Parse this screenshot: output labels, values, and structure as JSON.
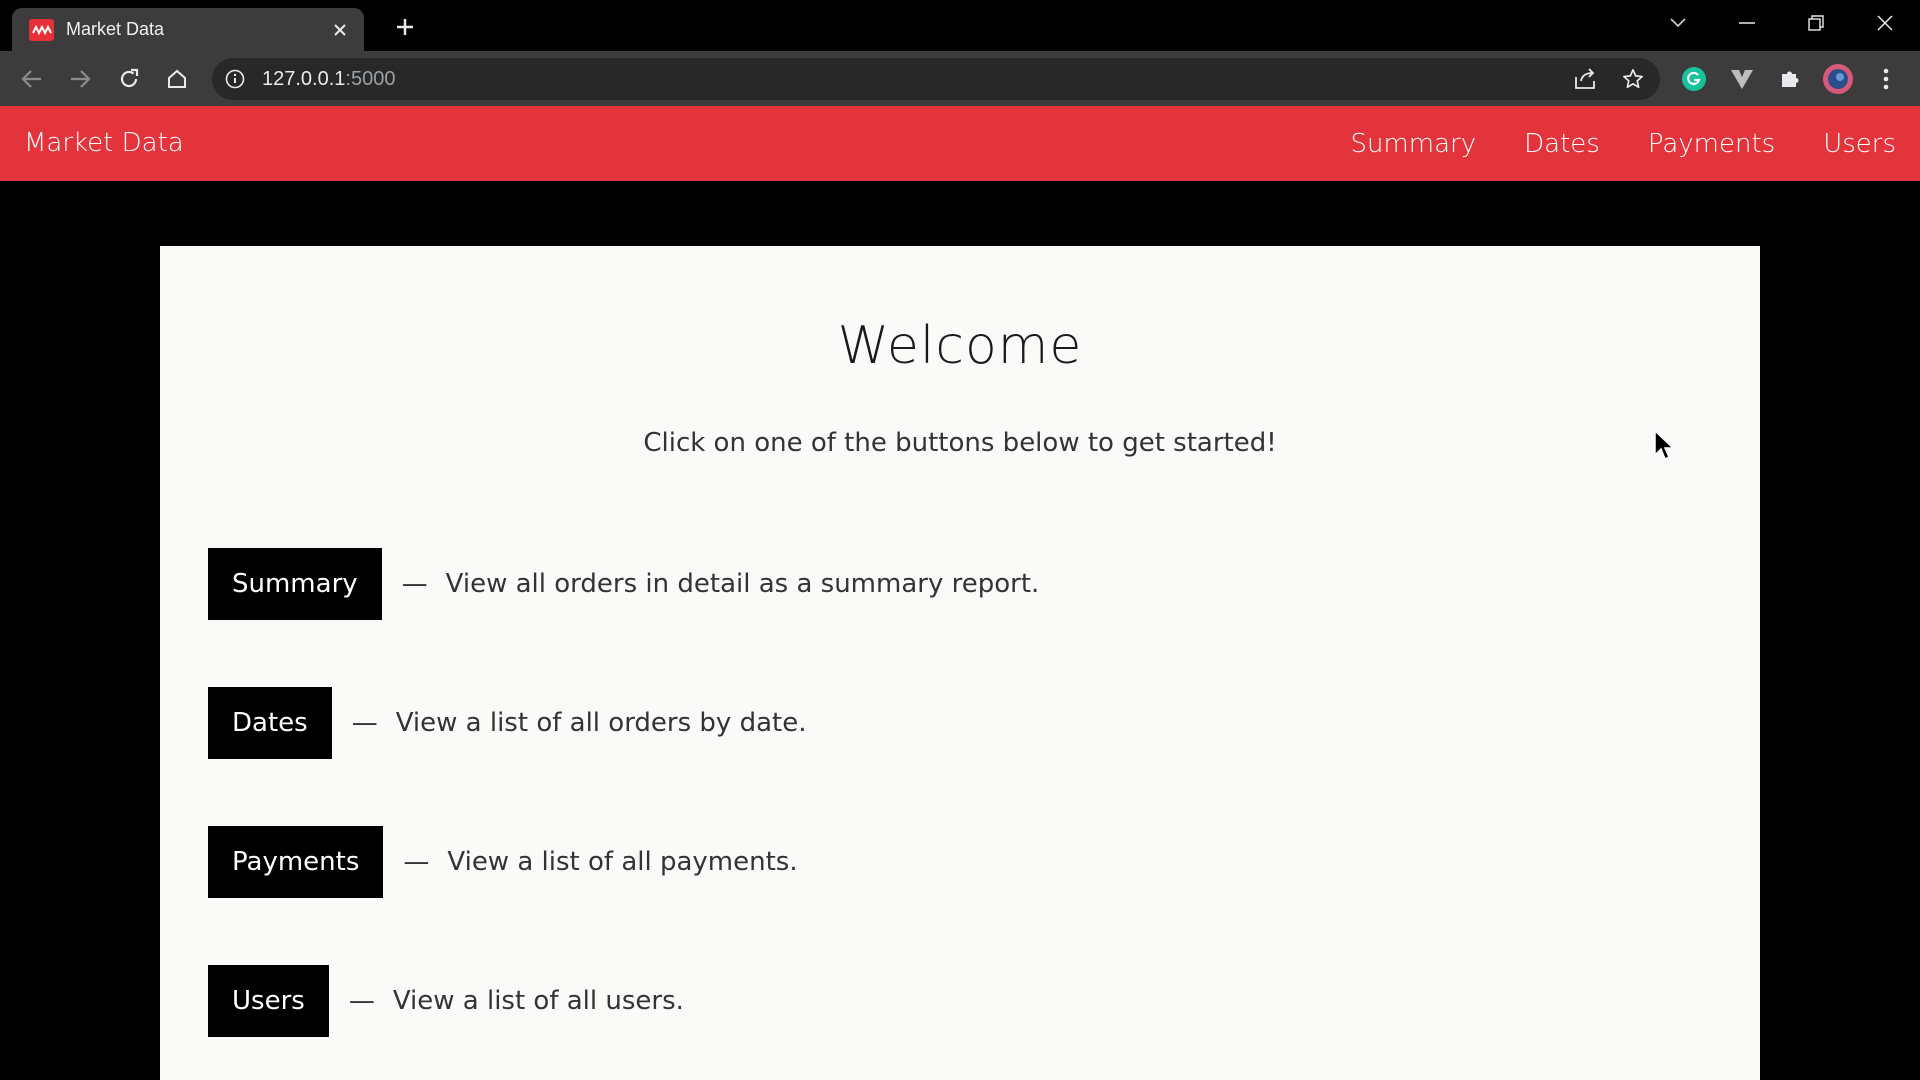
{
  "browser": {
    "tab_title": "Market Data",
    "url_host": "127.0.0.1",
    "url_port": ":5000",
    "theme": {
      "chrome_bg": "#000000",
      "toolbar_bg": "#3c3c3c",
      "omnibox_bg": "#282828"
    }
  },
  "navbar": {
    "brand": "Market Data",
    "links": [
      "Summary",
      "Dates",
      "Payments",
      "Users"
    ],
    "color": "#e3343c"
  },
  "main": {
    "title": "Welcome",
    "subtitle": "Click on one of the buttons below to get started!",
    "dash": "—",
    "actions": [
      {
        "label": "Summary",
        "description": "View all orders in detail as a summary report."
      },
      {
        "label": "Dates",
        "description": "View a list of all orders by date."
      },
      {
        "label": "Payments",
        "description": "View a list of all payments."
      },
      {
        "label": "Users",
        "description": "View a list of all users."
      }
    ]
  },
  "icons": {
    "favicon": "market-logo-icon",
    "tab_close": "close-icon",
    "new_tab": "plus-icon",
    "window": [
      "chevron-down-icon",
      "minimize-icon",
      "restore-icon",
      "close-icon"
    ],
    "toolbar": [
      "back-arrow-icon",
      "forward-arrow-icon",
      "reload-icon",
      "home-icon",
      "info-icon",
      "share-icon",
      "star-icon",
      "grammarly-icon",
      "vuetify-icon",
      "puzzle-icon",
      "profile-avatar",
      "kebab-menu-icon"
    ],
    "pointer": "mouse-cursor-icon"
  }
}
